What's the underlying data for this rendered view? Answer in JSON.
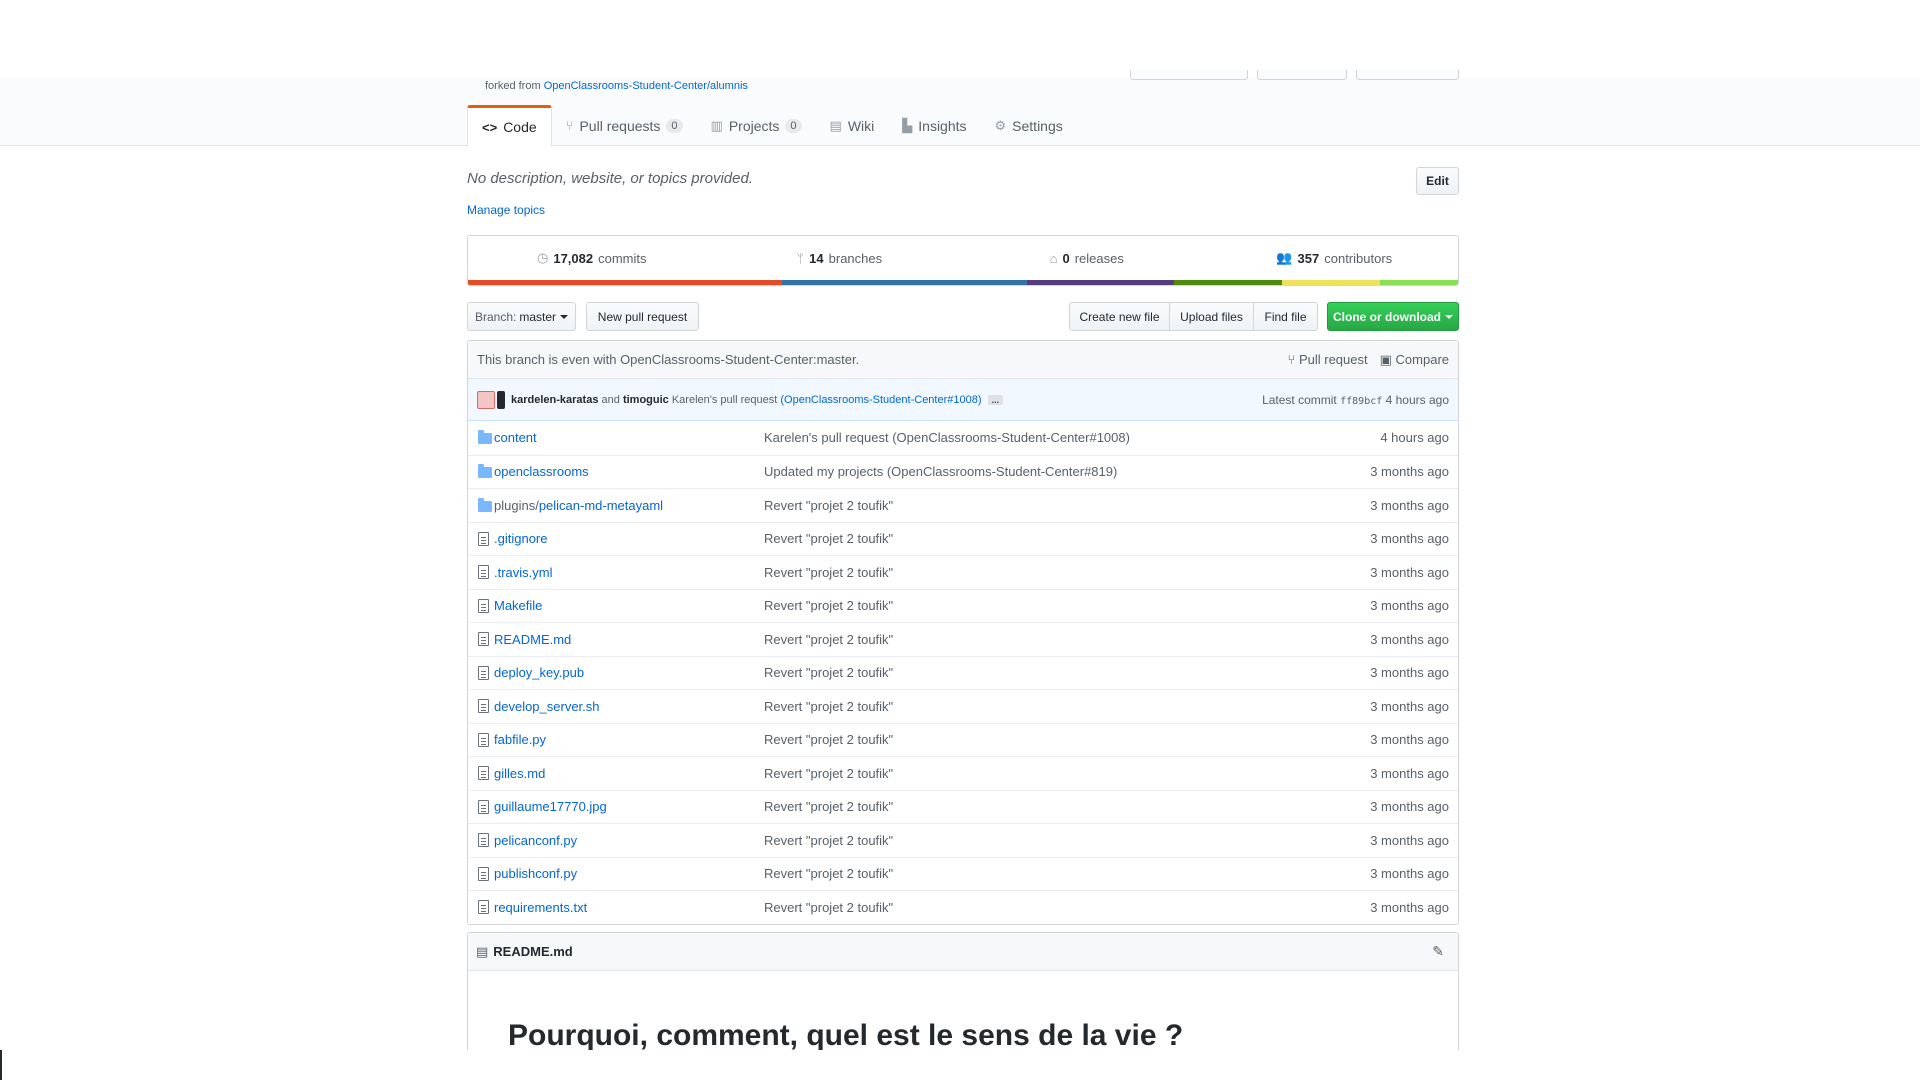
{
  "repo": {
    "forked_from_prefix": "forked from",
    "forked_from": "OpenClassrooms-Student-Center/alumnis",
    "description": "No description, website, or topics provided.",
    "manage_topics": "Manage topics",
    "edit": "Edit"
  },
  "nav": {
    "code": "Code",
    "pull_requests": "Pull requests",
    "pull_requests_count": "0",
    "projects": "Projects",
    "projects_count": "0",
    "wiki": "Wiki",
    "insights": "Insights",
    "settings": "Settings"
  },
  "summary": {
    "commits_count": "17,082",
    "commits_label": "commits",
    "branches_count": "14",
    "branches_label": "branches",
    "releases_count": "0",
    "releases_label": "releases",
    "contributors_count": "357",
    "contributors_label": "contributors",
    "language_colors": [
      "#e34c26",
      "#3572a5",
      "#563d7c",
      "#4f8a10",
      "#f1e05a",
      "#89e051"
    ]
  },
  "filebar": {
    "branch_prefix": "Branch:",
    "branch_name": "master",
    "new_pull_request": "New pull request",
    "create_new_file": "Create new file",
    "upload_files": "Upload files",
    "find_file": "Find file",
    "clone_or_download": "Clone or download"
  },
  "branch_info": {
    "text": "This branch is even with OpenClassrooms-Student-Center:master.",
    "pull_request": "Pull request",
    "compare": "Compare"
  },
  "latest_commit": {
    "author1": "kardelen-karatas",
    "and": "and",
    "author2": "timoguic",
    "message": "Karelen's pull request",
    "link": "(OpenClassrooms-Student-Center#1008)",
    "ellipsis": "...",
    "label": "Latest commit",
    "sha": "ff89bcf",
    "age": "4 hours ago"
  },
  "files": [
    {
      "type": "dir",
      "name": "content",
      "message": "Karelen's pull request (OpenClassrooms-Student-Center#1008)",
      "age": "4 hours ago"
    },
    {
      "type": "dir",
      "name": "openclassrooms",
      "message": "Updated my projects (OpenClassrooms-Student-Center#819)",
      "age": "3 months ago"
    },
    {
      "type": "dir",
      "name_prefix": "plugins/",
      "name": "pelican-md-metayaml",
      "message": "Revert \"projet 2 toufik\"",
      "age": "3 months ago"
    },
    {
      "type": "file",
      "name": ".gitignore",
      "message": "Revert \"projet 2 toufik\"",
      "age": "3 months ago"
    },
    {
      "type": "file",
      "name": ".travis.yml",
      "message": "Revert \"projet 2 toufik\"",
      "age": "3 months ago"
    },
    {
      "type": "file",
      "name": "Makefile",
      "message": "Revert \"projet 2 toufik\"",
      "age": "3 months ago"
    },
    {
      "type": "file",
      "name": "README.md",
      "message": "Revert \"projet 2 toufik\"",
      "age": "3 months ago"
    },
    {
      "type": "file",
      "name": "deploy_key.pub",
      "message": "Revert \"projet 2 toufik\"",
      "age": "3 months ago"
    },
    {
      "type": "file",
      "name": "develop_server.sh",
      "message": "Revert \"projet 2 toufik\"",
      "age": "3 months ago"
    },
    {
      "type": "file",
      "name": "fabfile.py",
      "message": "Revert \"projet 2 toufik\"",
      "age": "3 months ago"
    },
    {
      "type": "file",
      "name": "gilles.md",
      "message": "Revert \"projet 2 toufik\"",
      "age": "3 months ago"
    },
    {
      "type": "file",
      "name": "guillaume17770.jpg",
      "message": "Revert \"projet 2 toufik\"",
      "age": "3 months ago"
    },
    {
      "type": "file",
      "name": "pelicanconf.py",
      "message": "Revert \"projet 2 toufik\"",
      "age": "3 months ago"
    },
    {
      "type": "file",
      "name": "publishconf.py",
      "message": "Revert \"projet 2 toufik\"",
      "age": "3 months ago"
    },
    {
      "type": "file",
      "name": "requirements.txt",
      "message": "Revert \"projet 2 toufik\"",
      "age": "3 months ago"
    }
  ],
  "readme": {
    "filename": "README.md",
    "heading": "Pourquoi, comment, quel est le sens de la vie ?"
  }
}
